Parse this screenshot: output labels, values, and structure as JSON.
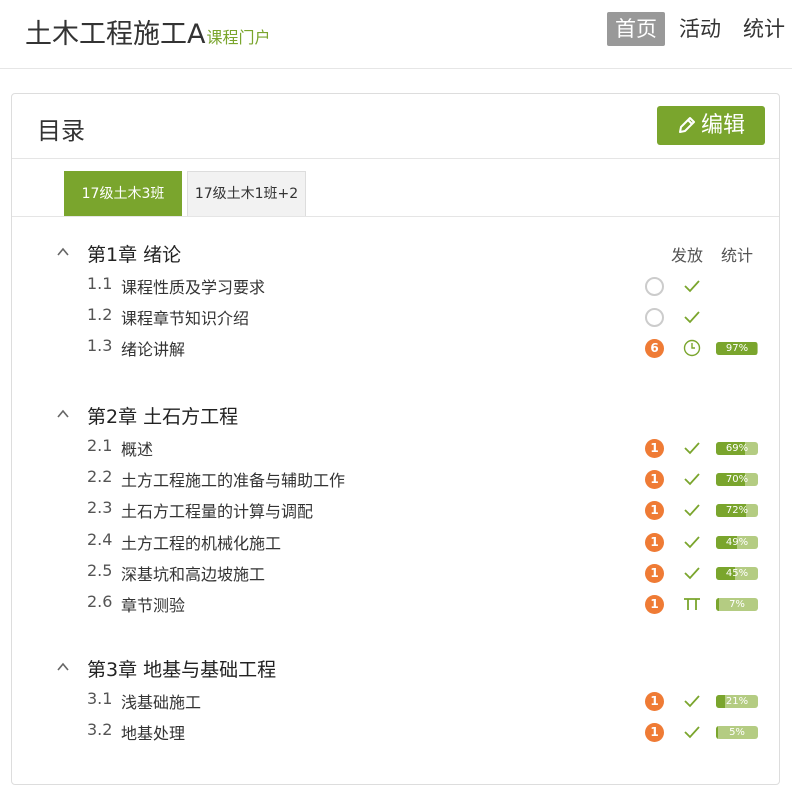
{
  "header": {
    "title": "土木工程施工A",
    "subtitle": "课程门户",
    "nav": [
      "首页",
      "活动",
      "统计"
    ]
  },
  "panel": {
    "title": "目录",
    "edit_label": "编辑",
    "tabs": [
      "17级土木3班",
      "17级土木1班+2"
    ]
  },
  "columns": {
    "release": "发放",
    "stats": "统计"
  },
  "chapters": [
    {
      "title": "第1章  绪论",
      "sections": [
        {
          "num": "1.1",
          "title": "课程性质及学习要求",
          "status": "empty",
          "count": "",
          "release": "check",
          "pct": null,
          "pct_label": ""
        },
        {
          "num": "1.2",
          "title": "课程章节知识介绍",
          "status": "empty",
          "count": "",
          "release": "check",
          "pct": null,
          "pct_label": ""
        },
        {
          "num": "1.3",
          "title": "绪论讲解",
          "status": "count",
          "count": "6",
          "release": "clock",
          "pct": 97,
          "pct_label": "97%"
        }
      ]
    },
    {
      "title": "第2章  土石方工程",
      "sections": [
        {
          "num": "2.1",
          "title": "概述",
          "status": "count",
          "count": "1",
          "release": "check",
          "pct": 69,
          "pct_label": "69%"
        },
        {
          "num": "2.2",
          "title": "土方工程施工的准备与辅助工作",
          "status": "count",
          "count": "1",
          "release": "check",
          "pct": 70,
          "pct_label": "70%"
        },
        {
          "num": "2.3",
          "title": "土石方工程量的计算与调配",
          "status": "count",
          "count": "1",
          "release": "check",
          "pct": 72,
          "pct_label": "72%"
        },
        {
          "num": "2.4",
          "title": "土方工程的机械化施工",
          "status": "count",
          "count": "1",
          "release": "check",
          "pct": 49,
          "pct_label": "49%"
        },
        {
          "num": "2.5",
          "title": "深基坑和高边坡施工",
          "status": "count",
          "count": "1",
          "release": "check",
          "pct": 45,
          "pct_label": "45%"
        },
        {
          "num": "2.6",
          "title": "章节测验",
          "status": "count",
          "count": "1",
          "release": "quiz",
          "pct": 7,
          "pct_label": "7%"
        }
      ]
    },
    {
      "title": "第3章  地基与基础工程",
      "sections": [
        {
          "num": "3.1",
          "title": "浅基础施工",
          "status": "count",
          "count": "1",
          "release": "check",
          "pct": 21,
          "pct_label": "21%"
        },
        {
          "num": "3.2",
          "title": "地基处理",
          "status": "count",
          "count": "1",
          "release": "check",
          "pct": 5,
          "pct_label": "5%"
        }
      ]
    }
  ],
  "colors": {
    "accent": "#7aa52d",
    "badge": "#ef7b35",
    "nav_active": "#999999"
  }
}
